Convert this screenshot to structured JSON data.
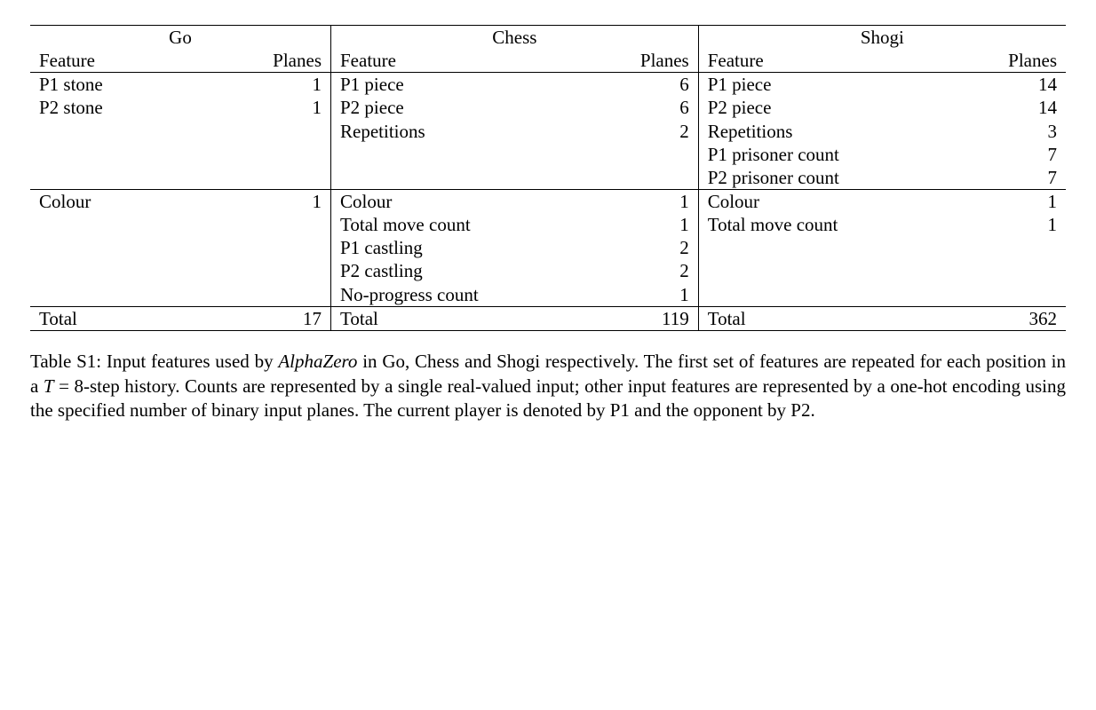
{
  "headers": {
    "go": "Go",
    "chess": "Chess",
    "shogi": "Shogi",
    "feature": "Feature",
    "planes": "Planes"
  },
  "section1": {
    "go": [
      {
        "f": "P1 stone",
        "p": "1"
      },
      {
        "f": "P2 stone",
        "p": "1"
      },
      {
        "f": "",
        "p": ""
      },
      {
        "f": "",
        "p": ""
      },
      {
        "f": "",
        "p": ""
      }
    ],
    "chess": [
      {
        "f": "P1 piece",
        "p": "6"
      },
      {
        "f": "P2 piece",
        "p": "6"
      },
      {
        "f": "Repetitions",
        "p": "2"
      },
      {
        "f": "",
        "p": ""
      },
      {
        "f": "",
        "p": ""
      }
    ],
    "shogi": [
      {
        "f": "P1 piece",
        "p": "14"
      },
      {
        "f": "P2 piece",
        "p": "14"
      },
      {
        "f": "Repetitions",
        "p": "3"
      },
      {
        "f": "P1 prisoner count",
        "p": "7"
      },
      {
        "f": "P2 prisoner count",
        "p": "7"
      }
    ]
  },
  "section2": {
    "go": [
      {
        "f": "Colour",
        "p": "1"
      },
      {
        "f": "",
        "p": ""
      },
      {
        "f": "",
        "p": ""
      },
      {
        "f": "",
        "p": ""
      },
      {
        "f": "",
        "p": ""
      }
    ],
    "chess": [
      {
        "f": "Colour",
        "p": "1"
      },
      {
        "f": "Total move count",
        "p": "1"
      },
      {
        "f": "P1 castling",
        "p": "2"
      },
      {
        "f": "P2 castling",
        "p": "2"
      },
      {
        "f": "No-progress count",
        "p": "1"
      }
    ],
    "shogi": [
      {
        "f": "Colour",
        "p": "1"
      },
      {
        "f": "Total move count",
        "p": "1"
      },
      {
        "f": "",
        "p": ""
      },
      {
        "f": "",
        "p": ""
      },
      {
        "f": "",
        "p": ""
      }
    ]
  },
  "totals": {
    "label": "Total",
    "go": "17",
    "chess": "119",
    "shogi": "362"
  },
  "caption": {
    "lead": "Table S1:  Input features used by ",
    "alphazero": "AlphaZero",
    "mid1": " in Go, Chess and Shogi respectively. The first set of features are repeated for each position in a ",
    "T": "T",
    "eq": " = 8",
    "mid2": "-step history. Counts are represented by a single real-valued input; other input features are represented by a one-hot encoding using the specified number of binary input planes. The current player is denoted by P1 and the opponent by P2."
  }
}
